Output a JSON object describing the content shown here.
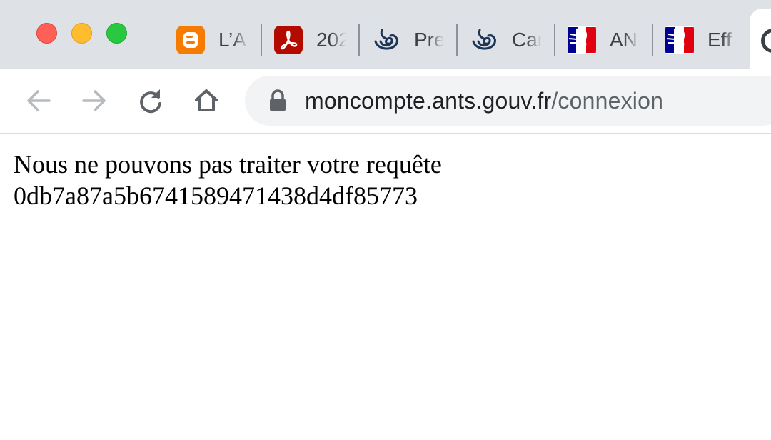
{
  "browser": {
    "tabs": [
      {
        "title": "L’A",
        "favicon": "blogger-icon",
        "favicon_color": "#f57c00"
      },
      {
        "title": "202",
        "favicon": "pdf-icon",
        "favicon_color": "#b30b00"
      },
      {
        "title": "Pre",
        "favicon": "knot-logo-icon",
        "favicon_color": "#1d3557"
      },
      {
        "title": "Car",
        "favicon": "knot-logo-icon",
        "favicon_color": "#1d3557"
      },
      {
        "title": "AN",
        "favicon": "marianne-icon",
        "favicon_color": "#000091"
      },
      {
        "title": "Eff",
        "favicon": "marianne-icon",
        "favicon_color": "#000091"
      }
    ],
    "active_tab_icon": "globe-icon",
    "toolbar": {
      "back_icon": "back-arrow-icon",
      "forward_icon": "forward-arrow-icon",
      "reload_icon": "reload-icon",
      "home_icon": "home-icon"
    },
    "address": {
      "host": "moncompte.ants.gouv.fr",
      "path": "/connexion",
      "lock_icon": "lock-icon"
    }
  },
  "page": {
    "error_message": "Nous ne pouvons pas traiter votre requête",
    "request_id": "0db7a87a5b6741589471438d4df85773"
  },
  "colors": {
    "tabstrip_bg": "#dee1e6",
    "omnibox_bg": "#f1f3f4",
    "traffic_red": "#fe5f57",
    "traffic_yellow": "#febc2e",
    "traffic_green": "#28c840"
  }
}
